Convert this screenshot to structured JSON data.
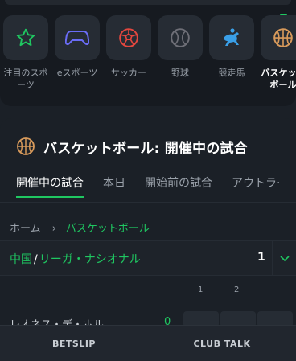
{
  "colors": {
    "accent": "#1fc761",
    "bg": "#1b2027",
    "tile": "#262c34",
    "muted": "#9aa1aa"
  },
  "sports": [
    {
      "label": "注目のスポ\nーツ",
      "icon": "star-icon"
    },
    {
      "label": "eスポーツ",
      "icon": "gamepad-icon"
    },
    {
      "label": "サッカー",
      "icon": "soccer-ball-icon"
    },
    {
      "label": "野球",
      "icon": "baseball-icon"
    },
    {
      "label": "競走馬",
      "icon": "horse-racing-icon"
    },
    {
      "label": "バスケット\nボール",
      "icon": "basketball-icon",
      "active": true
    }
  ],
  "section": {
    "title": "バスケットボール: 開催中の試合",
    "icon": "basketball-icon"
  },
  "tabs": [
    {
      "label": "開催中の試合",
      "active": true
    },
    {
      "label": "本日"
    },
    {
      "label": "開始前の試合"
    },
    {
      "label": "アウトラ·"
    }
  ],
  "breadcrumb": {
    "home": "ホーム",
    "separator": "›",
    "current": "バスケットボール"
  },
  "league": {
    "country": "中国",
    "separator": "/",
    "name": "リーガ・ナシオナル",
    "count": "1"
  },
  "periods": [
    "1",
    "2"
  ],
  "match": {
    "team": "レオネス・デ・ホル…",
    "score": "0"
  },
  "bottom": {
    "betslip": "BETSLIP",
    "club_talk": "CLUB TALK"
  }
}
